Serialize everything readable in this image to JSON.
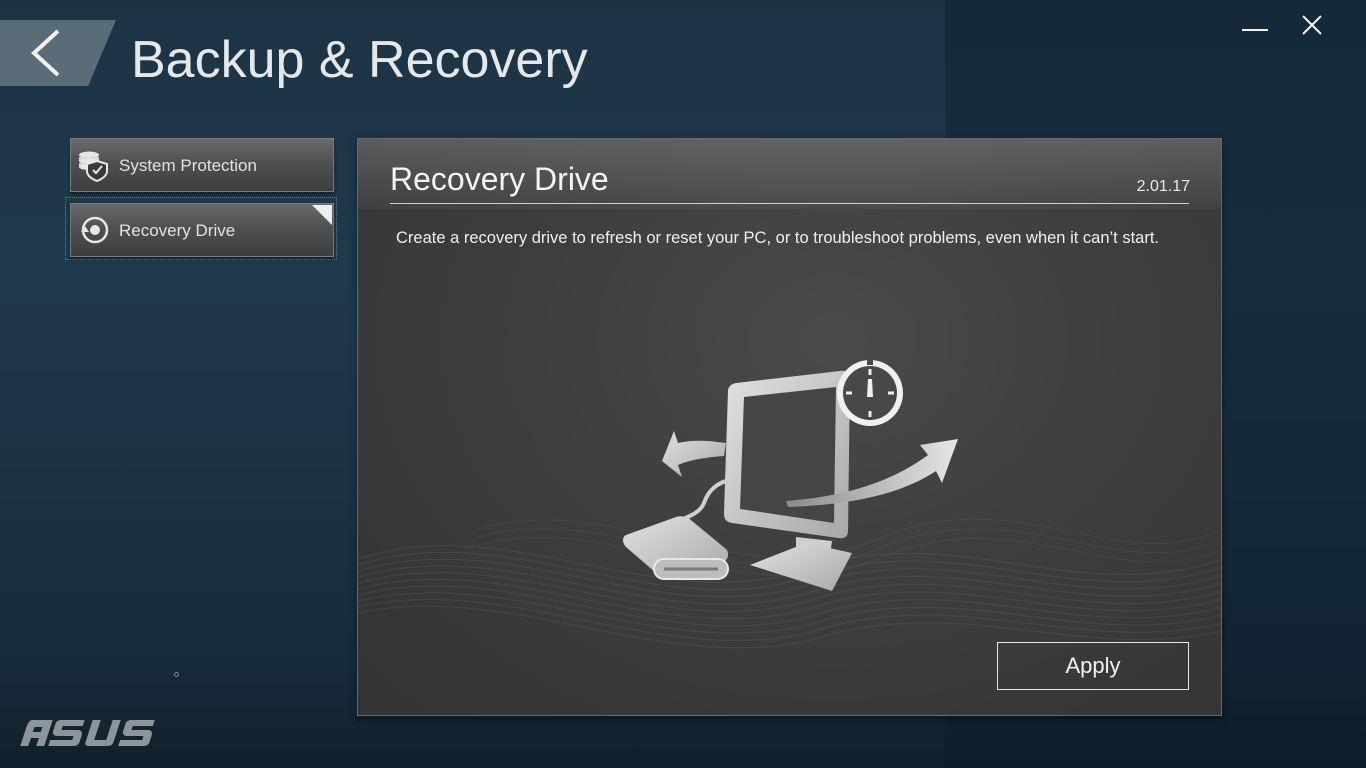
{
  "window": {
    "title": "Backup & Recovery"
  },
  "sidebar": {
    "items": [
      {
        "label": "System Protection",
        "icon": "shield-database-icon",
        "selected": false
      },
      {
        "label": "Recovery Drive",
        "icon": "disc-restore-icon",
        "selected": true
      }
    ]
  },
  "panel": {
    "title": "Recovery Drive",
    "version": "2.01.17",
    "description": "Create a recovery drive to refresh or reset your PC, or to troubleshoot problems, even when it can’t start.",
    "apply_label": "Apply"
  },
  "brand": {
    "logo_text": "ASUS"
  },
  "colors": {
    "background": "#1f3a4c",
    "panel": "#3e3e3e",
    "text": "#f0f0f0"
  }
}
